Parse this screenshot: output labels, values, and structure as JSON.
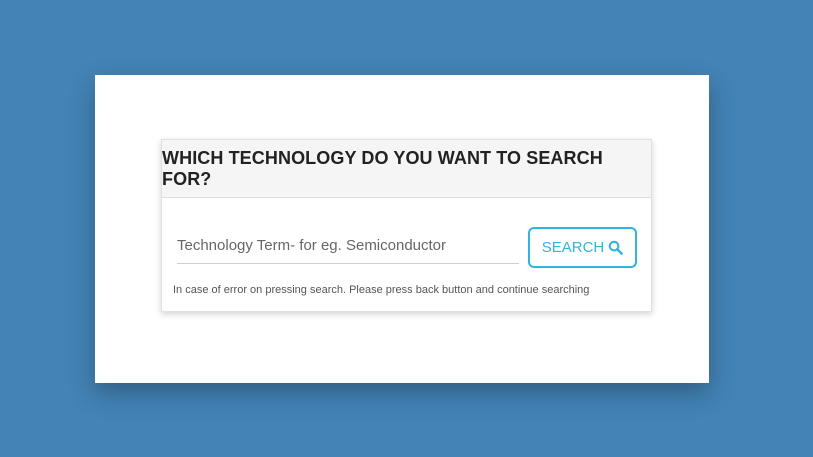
{
  "card": {
    "title": "WHICH TECHNOLOGY DO YOU WANT TO SEARCH FOR?",
    "search_placeholder": "Technology Term- for eg. Semiconductor",
    "search_value": "",
    "search_button_label": "SEARCH",
    "search_icon": "search-icon",
    "hint": "In case of error on pressing search. Please press back button and continue searching"
  },
  "colors": {
    "background": "#4383b6",
    "accent": "#32b4dc",
    "header_bg": "#f5f5f5"
  }
}
